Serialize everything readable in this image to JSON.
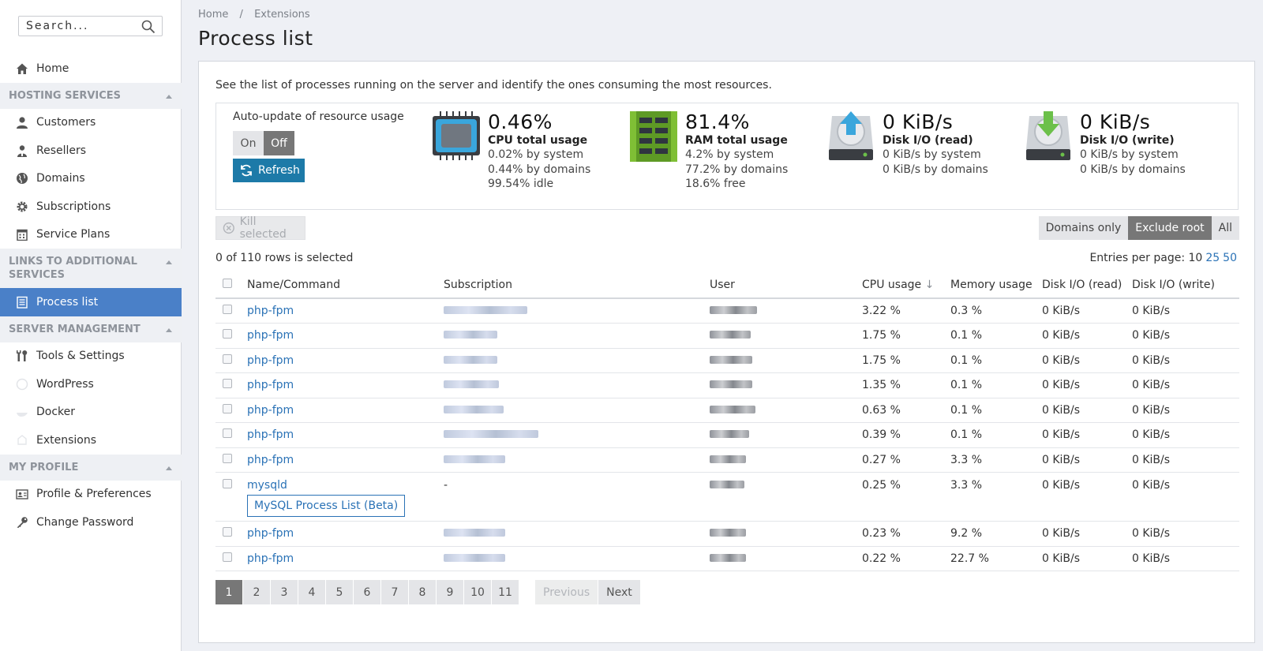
{
  "search": {
    "placeholder": "Search..."
  },
  "sidebar": {
    "home": "Home",
    "hosting_title": "HOSTING SERVICES",
    "hosting": [
      "Customers",
      "Resellers",
      "Domains",
      "Subscriptions",
      "Service Plans"
    ],
    "links_title": "LINKS TO ADDITIONAL SERVICES",
    "links": [
      "Process list"
    ],
    "server_title": "SERVER MANAGEMENT",
    "server": [
      "Tools & Settings",
      "WordPress",
      "Docker",
      "Extensions"
    ],
    "profile_title": "MY PROFILE",
    "profile": [
      "Profile & Preferences",
      "Change Password"
    ]
  },
  "breadcrumb": [
    "Home",
    "/",
    "Extensions"
  ],
  "page_title": "Process list",
  "intro": "See the list of processes running on the server and identify the ones consuming the most resources.",
  "auto_update": {
    "label": "Auto-update of resource usage",
    "on": "On",
    "off": "Off",
    "refresh": "Refresh"
  },
  "stats": {
    "cpu": {
      "value": "0.46%",
      "label": "CPU total usage",
      "lines": [
        "0.02% by system",
        "0.44% by domains",
        "99.54% idle"
      ]
    },
    "ram": {
      "value": "81.4%",
      "label": "RAM total usage",
      "lines": [
        "4.2% by system",
        "77.2% by domains",
        "18.6% free"
      ]
    },
    "disk_read": {
      "value": "0 KiB/s",
      "label": "Disk I/O (read)",
      "lines": [
        "0 KiB/s by system",
        "0 KiB/s by domains"
      ]
    },
    "disk_write": {
      "value": "0 KiB/s",
      "label": "Disk I/O (write)",
      "lines": [
        "0 KiB/s by system",
        "0 KiB/s by domains"
      ]
    }
  },
  "toolbar": {
    "kill": "Kill selected",
    "filters": [
      "Domains only",
      "Exclude root",
      "All"
    ]
  },
  "selection": "0 of 110 rows is selected",
  "entries": {
    "label": "Entries per page:",
    "current": "10",
    "options": [
      "25",
      "50"
    ]
  },
  "table": {
    "headers": [
      "Name/Command",
      "Subscription",
      "User",
      "CPU usage",
      "Memory usage",
      "Disk I/O (read)",
      "Disk I/O (write)"
    ],
    "rows": [
      {
        "name": "php-fpm",
        "cpu": "3.22 %",
        "mem": "0.3 %",
        "read": "0 KiB/s",
        "write": "0 KiB/s"
      },
      {
        "name": "php-fpm",
        "cpu": "1.75 %",
        "mem": "0.1 %",
        "read": "0 KiB/s",
        "write": "0 KiB/s"
      },
      {
        "name": "php-fpm",
        "cpu": "1.75 %",
        "mem": "0.1 %",
        "read": "0 KiB/s",
        "write": "0 KiB/s"
      },
      {
        "name": "php-fpm",
        "cpu": "1.35 %",
        "mem": "0.1 %",
        "read": "0 KiB/s",
        "write": "0 KiB/s"
      },
      {
        "name": "php-fpm",
        "cpu": "0.63 %",
        "mem": "0.1 %",
        "read": "0 KiB/s",
        "write": "0 KiB/s"
      },
      {
        "name": "php-fpm",
        "cpu": "0.39 %",
        "mem": "0.1 %",
        "read": "0 KiB/s",
        "write": "0 KiB/s"
      },
      {
        "name": "php-fpm",
        "cpu": "0.27 %",
        "mem": "3.3 %",
        "read": "0 KiB/s",
        "write": "0 KiB/s"
      },
      {
        "name": "mysqld",
        "subscription": "-",
        "extra": "MySQL Process List (Beta)",
        "cpu": "0.25 %",
        "mem": "3.3 %",
        "read": "0 KiB/s",
        "write": "0 KiB/s"
      },
      {
        "name": "php-fpm",
        "cpu": "0.23 %",
        "mem": "9.2 %",
        "read": "0 KiB/s",
        "write": "0 KiB/s"
      },
      {
        "name": "php-fpm",
        "cpu": "0.22 %",
        "mem": "22.7 %",
        "read": "0 KiB/s",
        "write": "0 KiB/s"
      }
    ]
  },
  "pagination": {
    "pages": [
      "1",
      "2",
      "3",
      "4",
      "5",
      "6",
      "7",
      "8",
      "9",
      "10",
      "11"
    ],
    "previous": "Previous",
    "next": "Next"
  },
  "colors": {
    "accent": "#4a80c8",
    "link": "#2a72b6",
    "refresh": "#1d7aa8"
  }
}
